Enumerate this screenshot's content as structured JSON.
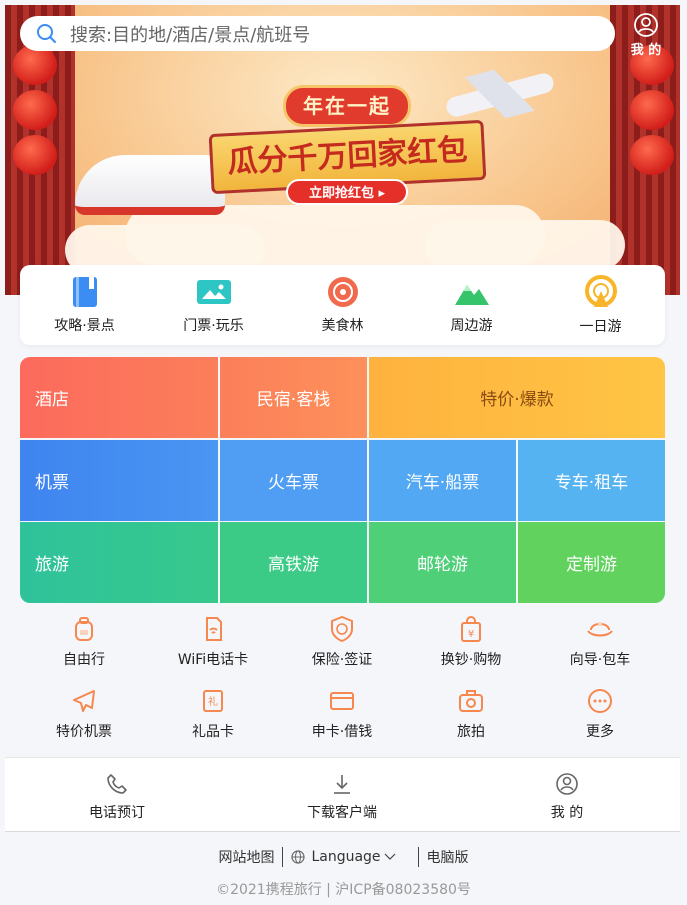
{
  "search": {
    "placeholder": "搜索:目的地/酒店/景点/航班号"
  },
  "header": {
    "me_label": "我 的"
  },
  "banner": {
    "tag": "年在一起",
    "title": "瓜分千万回家红包",
    "button": "立即抢红包 ▸"
  },
  "quick_nav": [
    {
      "label": "攻略·景点",
      "icon": "guide-book-icon",
      "color": "#3b8cf3"
    },
    {
      "label": "门票·玩乐",
      "icon": "ticket-icon",
      "color": "#2ec6c4"
    },
    {
      "label": "美食林",
      "icon": "food-icon",
      "color": "#f26a4d"
    },
    {
      "label": "周边游",
      "icon": "mountain-icon",
      "color": "#35c46a"
    },
    {
      "label": "一日游",
      "icon": "ferris-wheel-icon",
      "color": "#f9b529"
    }
  ],
  "grid": {
    "hotel": "酒店",
    "homestay": "民宿·客栈",
    "deals": "特价·爆款",
    "flight": "机票",
    "train": "火车票",
    "bus": "汽车·船票",
    "car": "专车·租车",
    "travel": "旅游",
    "rail_tour": "高铁游",
    "cruise": "邮轮游",
    "custom": "定制游"
  },
  "services": [
    {
      "label": "自由行",
      "icon": "backpack-icon"
    },
    {
      "label": "WiFi电话卡",
      "icon": "wifi-card-icon"
    },
    {
      "label": "保险·签证",
      "icon": "shield-icon"
    },
    {
      "label": "换钞·购物",
      "icon": "shopping-bag-icon"
    },
    {
      "label": "向导·包车",
      "icon": "guide-hat-icon"
    },
    {
      "label": "特价机票",
      "icon": "plane-icon"
    },
    {
      "label": "礼品卡",
      "icon": "gift-card-icon"
    },
    {
      "label": "申卡·借钱",
      "icon": "credit-card-icon"
    },
    {
      "label": "旅拍",
      "icon": "camera-icon"
    },
    {
      "label": "更多",
      "icon": "more-icon"
    }
  ],
  "bottom_bar": {
    "phone": "电话预订",
    "download": "下载客户端",
    "me": "我 的"
  },
  "footer": {
    "sitemap": "网站地图",
    "language": "Language",
    "desktop": "电脑版",
    "copyright": "©2021携程旅行 | 沪ICP备08023580号"
  },
  "colors": {
    "accent": "#3b8cf3",
    "service_orange": "#f5874f"
  }
}
